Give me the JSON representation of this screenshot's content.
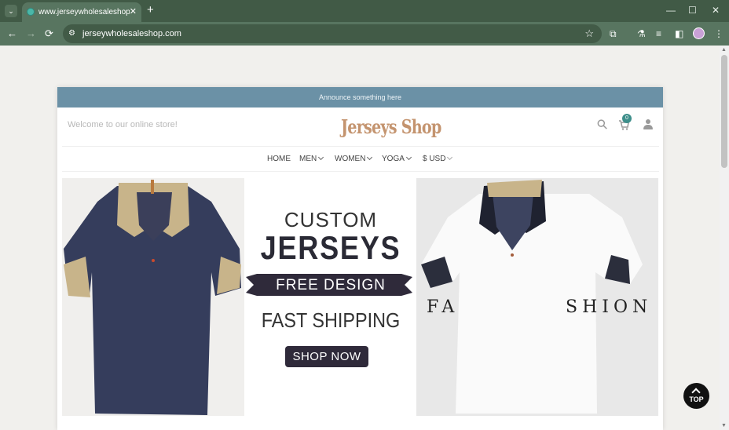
{
  "browser": {
    "tab_title": "www.jerseywholesaleshop.com",
    "tab_close": "✕",
    "new_tab": "+",
    "url": "jerseywholesaleshop.com",
    "tab_list_icon": "⌄",
    "back_icon": "←",
    "forward_icon": "→",
    "reload_icon": "⟳",
    "star_icon": "☆",
    "minimize_icon": "—",
    "maximize_icon": "☐",
    "close_window_icon": "✕",
    "extensions_icon": "⧉",
    "labs_icon": "⚗",
    "media_icon": "≡",
    "sidepanel_icon": "◧",
    "menu_icon": "⋮",
    "site_info_icon": "⚙"
  },
  "store": {
    "announcement": "Announce something here",
    "welcome": "Welcome to our online store!",
    "logo": "Jerseys Shop",
    "cart_count": "0",
    "search_icon": "⚲",
    "cart_icon": "🛒",
    "nav": [
      {
        "label": "HOME"
      },
      {
        "label": "MEN"
      },
      {
        "label": "WOMEN"
      },
      {
        "label": "YOGA"
      },
      {
        "label": "$ USD"
      }
    ]
  },
  "banner": {
    "line1": "CUSTOM",
    "line2": "JERSEYS",
    "ribbon": "FREE DESIGN",
    "line3": "FAST SHIPPING",
    "button": "SHOP NOW",
    "fashion_left": "FA",
    "fashion_right": "SHION"
  },
  "scroll_top": "TOP",
  "colors": {
    "browser_frame": "#415a46",
    "announcement_bar": "#6b91a6",
    "logo": "#c4946f",
    "cart_badge": "#3e8f8b",
    "shirt_navy": "#353d5c",
    "shop_button": "#2f2a3a"
  }
}
